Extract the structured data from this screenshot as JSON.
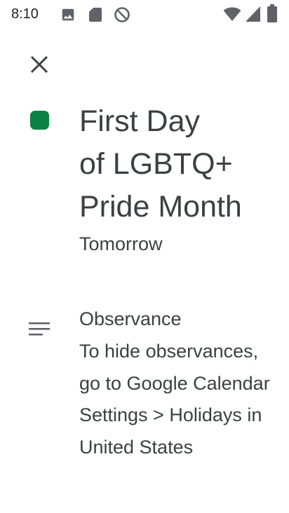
{
  "status_bar": {
    "time": "8:10",
    "left_icons": [
      "photo-icon",
      "sd-card-icon",
      "do-not-disturb-icon"
    ],
    "right_icons": [
      "wifi-icon",
      "cellular-signal-icon",
      "battery-icon"
    ]
  },
  "toolbar": {
    "close_icon": "close-icon"
  },
  "event": {
    "color": "#0b8043",
    "title_lines": [
      "First Day",
      "of LGBTQ+",
      "Pride Month"
    ],
    "date": "Tomorrow"
  },
  "description": {
    "icon": "notes-icon",
    "calendar": "Observance",
    "text": "To hide observances, go to Google Calendar Settings > Holidays in United States"
  }
}
